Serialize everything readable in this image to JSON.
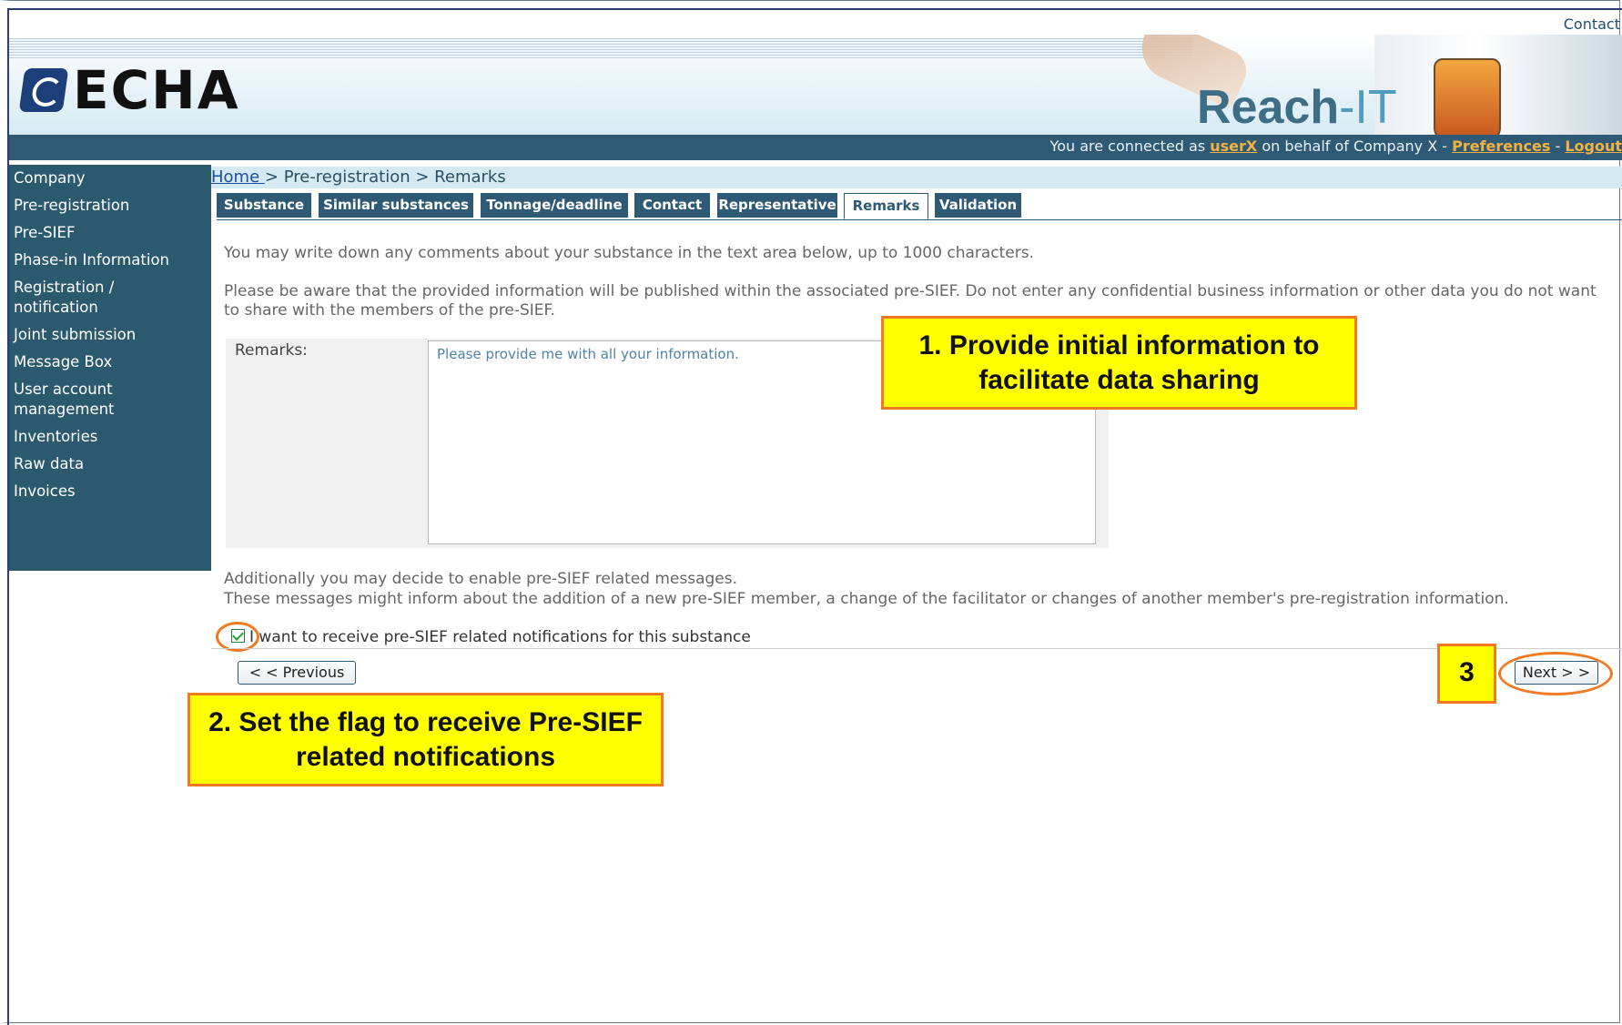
{
  "header": {
    "contact_link": "Contact",
    "brand_logo": "ECHA",
    "product_name_prefix": "Reach",
    "product_name_suffix": "-IT",
    "connection_prefix": "You are connected as ",
    "user": "userX",
    "connection_middle": " on behalf of Company X - ",
    "preferences": "Preferences",
    "separator": " - ",
    "logout": "Logout"
  },
  "sidebar": {
    "items": [
      {
        "label": "Company"
      },
      {
        "label": "Pre-registration"
      },
      {
        "label": "Pre-SIEF"
      },
      {
        "label": "Phase-in Information"
      },
      {
        "label": "Registration /\nnotification"
      },
      {
        "label": "Joint submission"
      },
      {
        "label": "Message Box"
      },
      {
        "label": "User account\nmanagement"
      },
      {
        "label": "Inventories"
      },
      {
        "label": "Raw data"
      },
      {
        "label": "Invoices"
      }
    ]
  },
  "breadcrumb": {
    "home": "Home ",
    "rest": "> Pre-registration > Remarks"
  },
  "tabs": [
    {
      "label": "Substance"
    },
    {
      "label": "Similar substances"
    },
    {
      "label": "Tonnage/deadline"
    },
    {
      "label": "Contact"
    },
    {
      "label": "Representative"
    },
    {
      "label": "Remarks",
      "active": true
    },
    {
      "label": "Validation"
    }
  ],
  "content": {
    "intro": "You may write down any comments about your substance in the text area below, up to 1000 characters.",
    "warning": "Please be aware that the provided information will be published within the associated pre-SIEF. Do not enter any confidential business information or other data you do not want to share with the members of the pre-SIEF.",
    "remarks_label": "Remarks:",
    "remarks_value": "Please provide me with all your information.",
    "additional_1": "Additionally you may decide to enable pre-SIEF related messages.",
    "additional_2": "These messages might inform about the addition of a new pre-SIEF member, a change of the facilitator or changes of another member's pre-registration information.",
    "checkbox_label": "I want to receive pre-SIEF related notifications for this substance",
    "checkbox_checked": true
  },
  "buttons": {
    "previous": "< < Previous",
    "next": "Next > >"
  },
  "callouts": {
    "one": "1. Provide initial information to facilitate data sharing",
    "two": "2. Set the flag to receive Pre-SIEF related notifications",
    "three": "3"
  },
  "colors": {
    "sidebar_bg": "#2b5a6f",
    "tab_bg": "#2f5a75",
    "callout_fill": "#ffff00",
    "callout_border": "#f07a22",
    "link_highlight": "#f3b13f"
  }
}
